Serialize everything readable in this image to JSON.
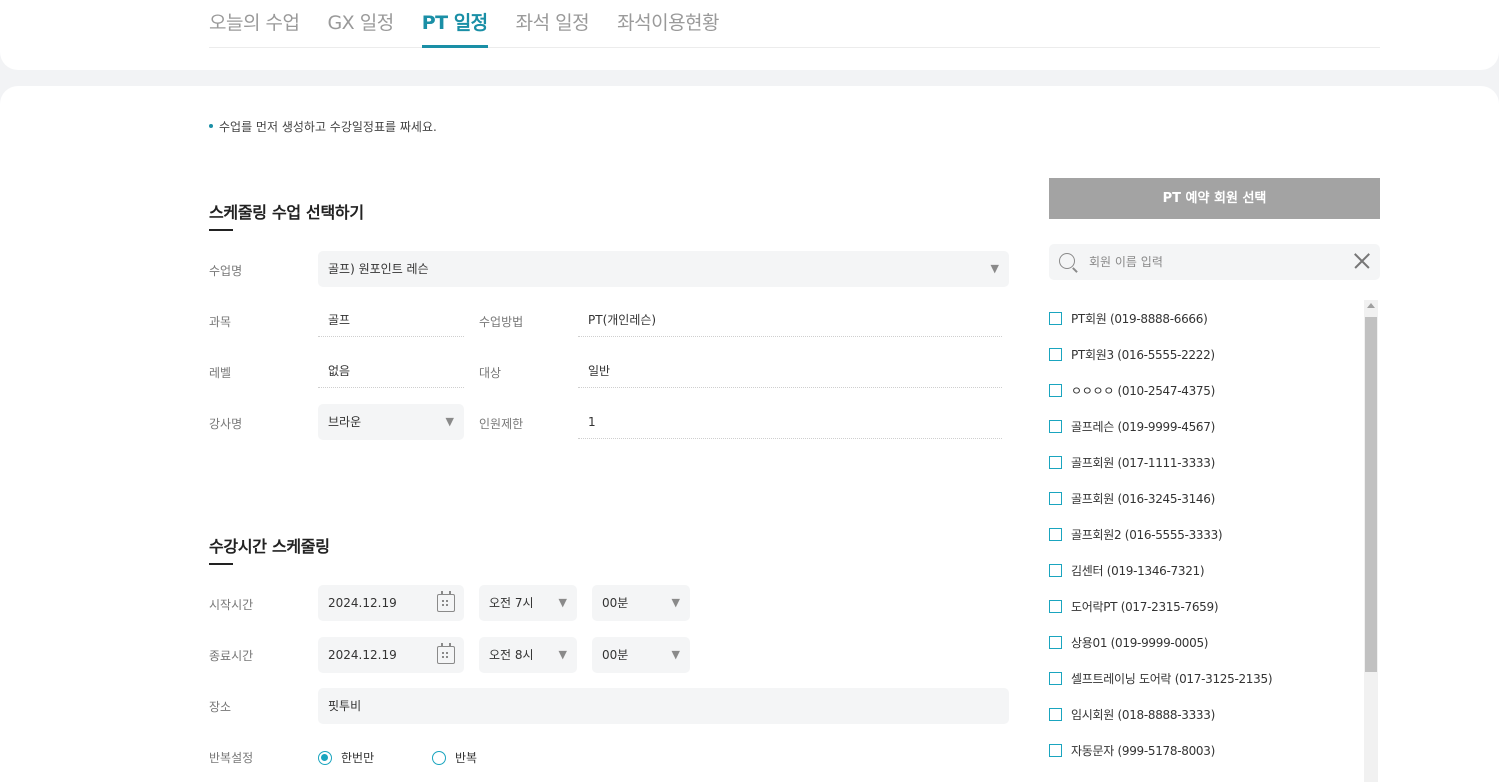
{
  "tabs": [
    {
      "label": "오늘의 수업",
      "active": false
    },
    {
      "label": "GX 일정",
      "active": false
    },
    {
      "label": "PT 일정",
      "active": true
    },
    {
      "label": "좌석 일정",
      "active": false
    },
    {
      "label": "좌석이용현황",
      "active": false
    }
  ],
  "notice": "수업를 먼저 생성하고 수강일정표를 짜세요.",
  "class_section": {
    "title": "스케줄링 수업 선택하기",
    "class_name_label": "수업명",
    "class_name_value": "골프) 원포인트 레슨",
    "subject_label": "과목",
    "subject_value": "골프",
    "method_label": "수업방법",
    "method_value": "PT(개인레슨)",
    "level_label": "레벨",
    "level_value": "없음",
    "target_label": "대상",
    "target_value": "일반",
    "instructor_label": "강사명",
    "instructor_value": "브라운",
    "capacity_label": "인원제한",
    "capacity_value": "1"
  },
  "time_section": {
    "title": "수강시간 스케줄링",
    "start_label": "시작시간",
    "start_date": "2024.12.19",
    "start_hour": "오전 7시",
    "start_min": "00분",
    "end_label": "종료시간",
    "end_date": "2024.12.19",
    "end_hour": "오전 8시",
    "end_min": "00분",
    "place_label": "장소",
    "place_value": "핏투비",
    "repeat_label": "반복설정",
    "repeat_once": "한번만",
    "repeat_multi": "반복"
  },
  "member_panel": {
    "header": "PT 예약 회원 선택",
    "search_placeholder": "회원 이름 입력",
    "members": [
      "PT회원 (019-8888-6666)",
      "PT회원3 (016-5555-2222)",
      "ㅇㅇㅇㅇ (010-2547-4375)",
      "골프레슨 (019-9999-4567)",
      "골프회원 (017-1111-3333)",
      "골프회원 (016-3245-3146)",
      "골프회원2 (016-5555-3333)",
      "김센터 (019-1346-7321)",
      "도어락PT (017-2315-7659)",
      "상용01 (019-9999-0005)",
      "셀프트레이닝 도어락 (017-3125-2135)",
      "임시회원 (018-8888-3333)",
      "자동문자 (999-5178-8003)"
    ]
  },
  "colors": {
    "accent": "#1a8fa6",
    "checkbox": "#1aa5bf",
    "header_bg": "#a3a3a3"
  }
}
